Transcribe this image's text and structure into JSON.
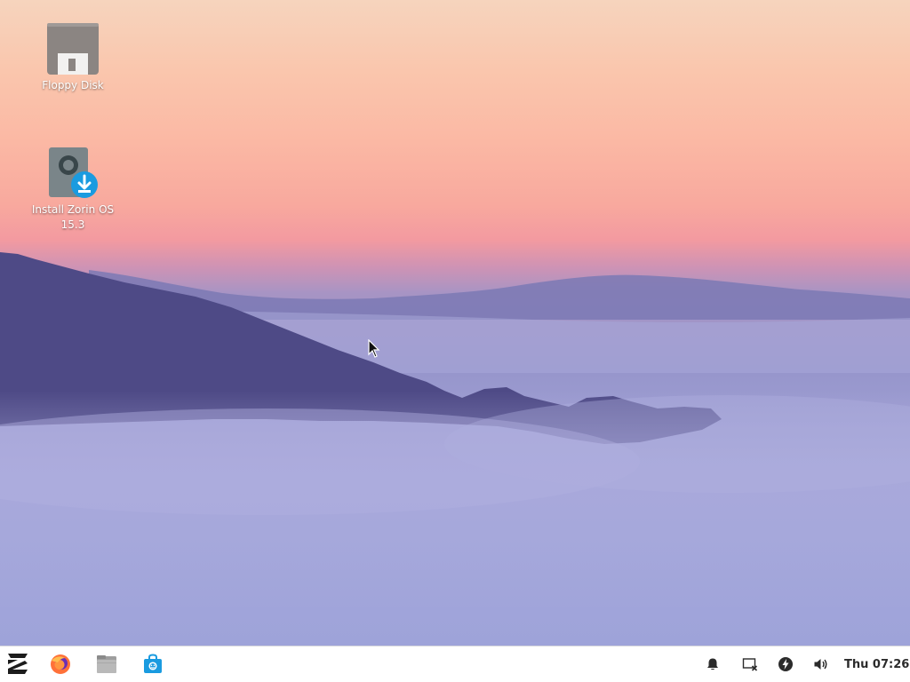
{
  "desktop": {
    "icons": [
      {
        "label": "Floppy Disk",
        "icon": "floppy-disk-icon"
      },
      {
        "label": "Install Zorin OS 15.3",
        "icon": "install-disk-icon"
      }
    ]
  },
  "taskbar": {
    "launchers": [
      {
        "name": "Zorin Menu",
        "icon": "zorin-logo-icon"
      },
      {
        "name": "Firefox",
        "icon": "firefox-icon"
      },
      {
        "name": "Files",
        "icon": "files-icon"
      },
      {
        "name": "Software",
        "icon": "software-store-icon"
      }
    ],
    "tray": [
      {
        "icon": "bell-icon"
      },
      {
        "icon": "display-icon"
      },
      {
        "icon": "power-icon"
      },
      {
        "icon": "volume-icon"
      }
    ],
    "clock": "Thu 07:26"
  },
  "colors": {
    "accent": "#1a9be0",
    "taskbar_bg": "#ffffff",
    "tray_icon": "#2b2b2b"
  }
}
